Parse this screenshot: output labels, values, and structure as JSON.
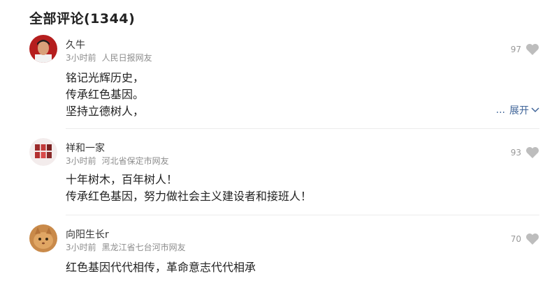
{
  "header": {
    "title": "全部评论(1344)"
  },
  "comments": [
    {
      "user": "久牛",
      "time": "3小时前",
      "location": "人民日报网友",
      "likes": "97",
      "lines": [
        "铭记光辉历史，",
        "传承红色基因。",
        "坚持立德树人，"
      ],
      "expand_dots": "...",
      "expand_label": "展开"
    },
    {
      "user": "祥和一家",
      "time": "3小时前",
      "location": "河北省保定市网友",
      "likes": "93",
      "lines": [
        "十年树木，百年树人！",
        "传承红色基因，努力做社会主义建设者和接班人！"
      ]
    },
    {
      "user": "向阳生长r",
      "time": "3小时前",
      "location": "黑龙江省七台河市网友",
      "likes": "70",
      "lines": [
        "红色基因代代相传，革命意志代代相承"
      ]
    }
  ],
  "colors": {
    "link": "#406599",
    "meta": "#8c8c8c",
    "heart": "#bdbdbd"
  },
  "icons": {
    "like": "heart-icon",
    "expand": "chevron-down-icon"
  }
}
